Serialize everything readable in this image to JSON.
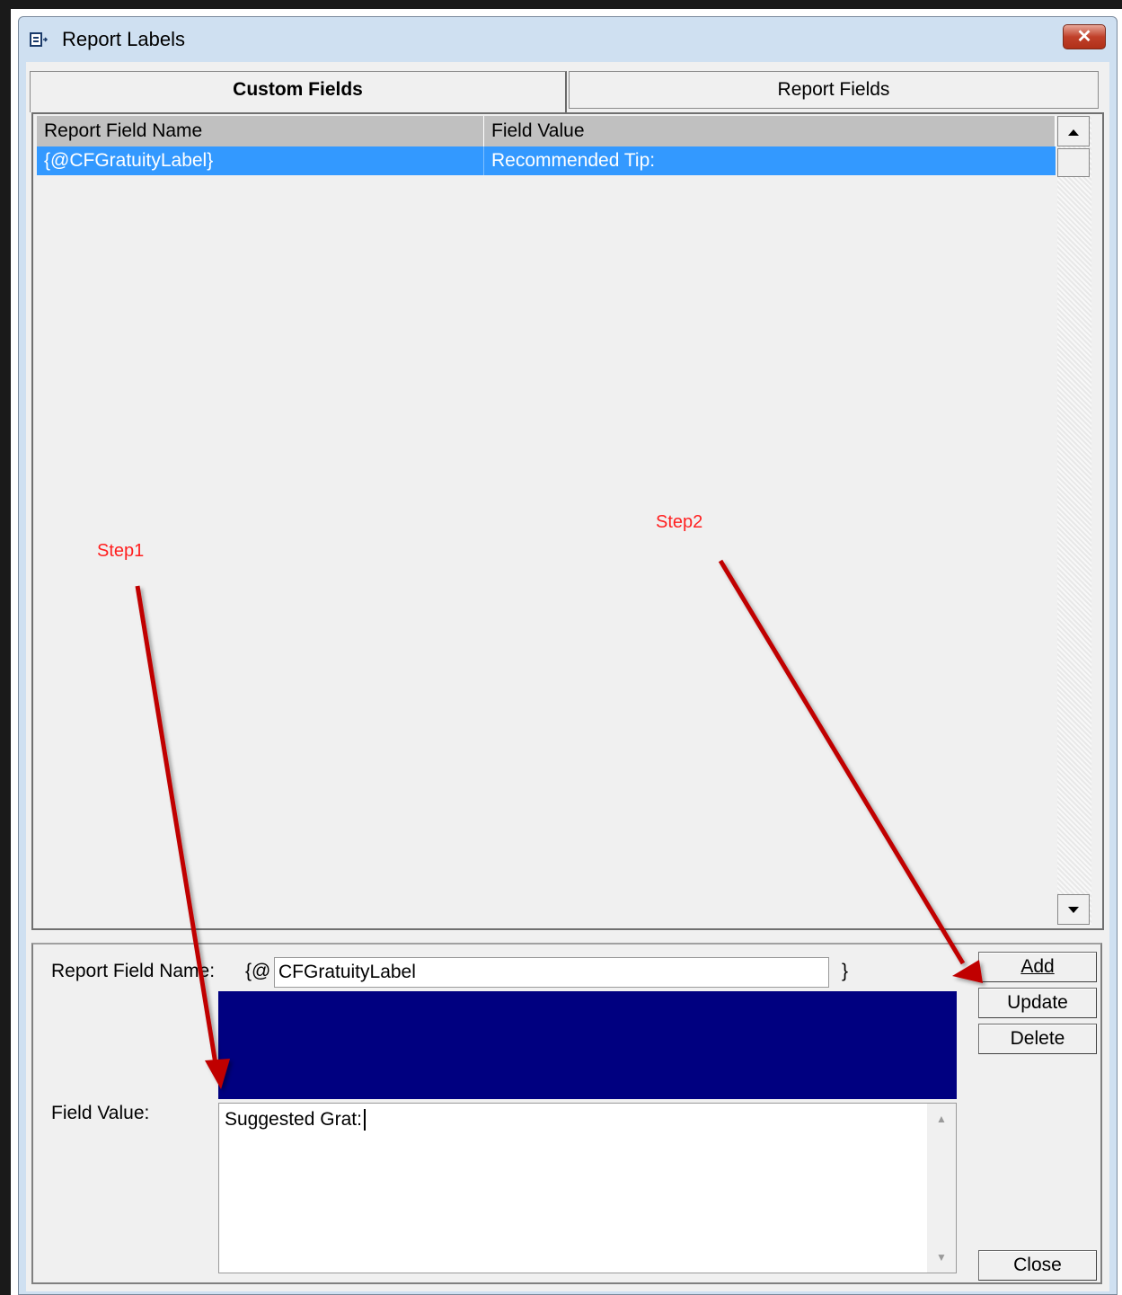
{
  "window": {
    "title": "Report Labels",
    "close_glyph": "✕"
  },
  "tabs": [
    {
      "label": "Custom Fields",
      "active": true
    },
    {
      "label": "Report Fields",
      "active": false
    }
  ],
  "grid": {
    "columns": [
      "Report Field Name",
      "Field Value"
    ],
    "rows": [
      {
        "name": "{@CFGratuityLabel}",
        "value": "Recommended Tip:",
        "selected": true
      }
    ]
  },
  "editor": {
    "name_label": "Report Field Name:",
    "name_prefix": "{@",
    "name_value": "CFGratuityLabel",
    "name_suffix": "}",
    "value_label": "Field Value:",
    "value_text": "Suggested Grat:"
  },
  "buttons": {
    "add": "Add",
    "update": "Update",
    "delete": "Delete",
    "close": "Close"
  },
  "annotations": {
    "step1": "Step1",
    "step2": "Step2"
  },
  "colors": {
    "selection": "#3399ff",
    "navy_panel": "#000080",
    "arrow": "#c00000",
    "annotation_text": "#ff2020"
  },
  "icons": [
    "app-icon",
    "close-icon",
    "scroll-up-icon",
    "scroll-down-icon"
  ]
}
